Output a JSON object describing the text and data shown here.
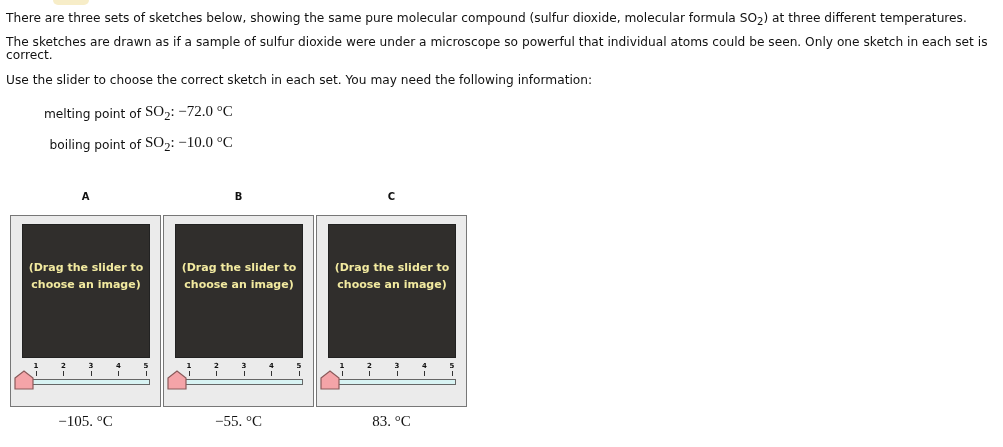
{
  "intro": [
    "There are three sets of sketches below, showing the same pure molecular compound (sulfur dioxide, molecular formula SO$_{2}$) at three different temperatures.",
    "The sketches are drawn as if a sample of sulfur dioxide were under a microscope so powerful that individual atoms could be seen. Only one sketch in each set is correct.",
    "Use the slider to choose the correct sketch in each set. You may need the following information:"
  ],
  "info": [
    {
      "label": "melting point of",
      "value": "SO$_{2}$: −72.0 °C"
    },
    {
      "label": "boiling point of",
      "value": "SO$_{2}$: −10.0 °C"
    }
  ],
  "sets": [
    {
      "heading": "A",
      "prompt": "(Drag the slider to choose an image)",
      "ticks": [
        "1",
        "2",
        "3",
        "4",
        "5"
      ],
      "level": 0,
      "temperature": "−105. °C"
    },
    {
      "heading": "B",
      "prompt": "(Drag the slider to choose an image)",
      "ticks": [
        "1",
        "2",
        "3",
        "4",
        "5"
      ],
      "level": 0,
      "temperature": "−55. °C"
    },
    {
      "heading": "C",
      "prompt": "(Drag the slider to choose an image)",
      "ticks": [
        "1",
        "2",
        "3",
        "4",
        "5"
      ],
      "level": 0,
      "temperature": "83. °C"
    }
  ]
}
